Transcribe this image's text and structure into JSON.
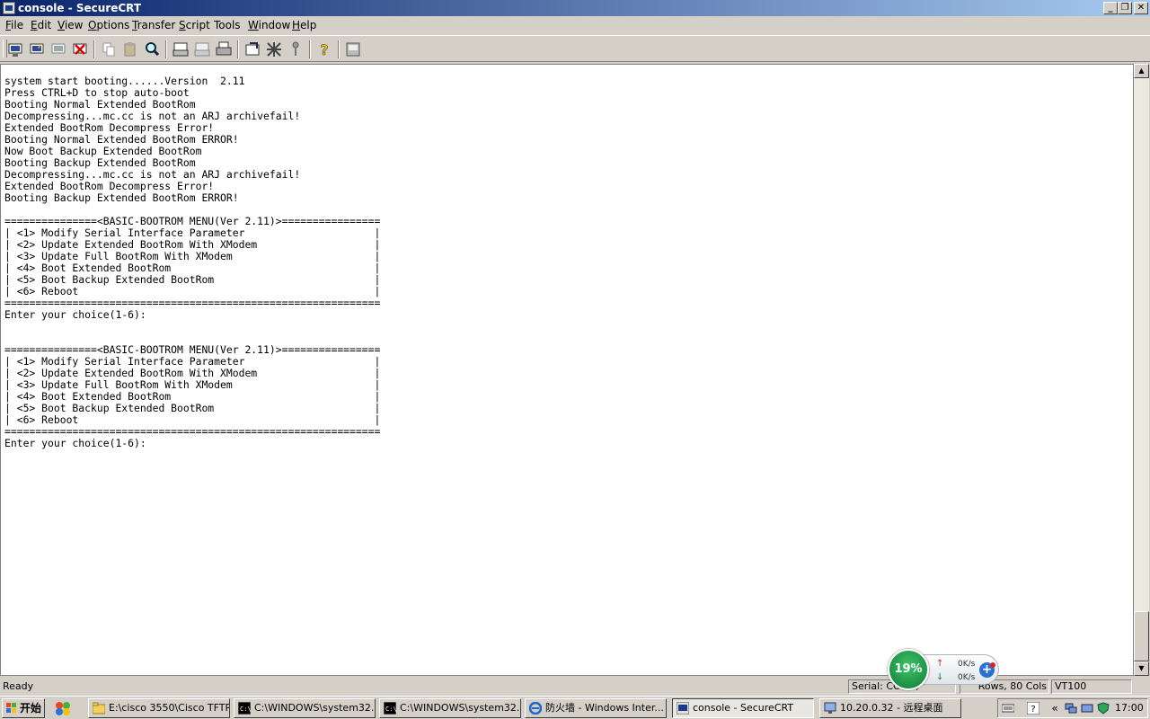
{
  "window": {
    "title": "console - SecureCRT",
    "controls": {
      "minimize": "_",
      "restore": "❐",
      "close": "✕"
    }
  },
  "menu": [
    {
      "label": "File",
      "key": "F",
      "rest": "ile"
    },
    {
      "label": "Edit",
      "key": "E",
      "rest": "dit"
    },
    {
      "label": "View",
      "key": "V",
      "rest": "iew"
    },
    {
      "label": "Options",
      "key": "O",
      "rest": "ptions"
    },
    {
      "label": "Transfer",
      "key": "T",
      "rest": "ransfer"
    },
    {
      "label": "Script",
      "key": "S",
      "rest": "cript"
    },
    {
      "label": "Tools",
      "key": "",
      "rest": "Tools"
    },
    {
      "label": "Window",
      "key": "W",
      "rest": "indow"
    },
    {
      "label": "Help",
      "key": "H",
      "rest": "elp"
    }
  ],
  "toolbar_icons": [
    "connect-icon",
    "quick-connect-icon",
    "reconnect-icon",
    "disconnect-icon",
    "copy-icon",
    "paste-icon",
    "find-icon",
    "print-screen-icon",
    "print-selection-icon",
    "print-icon",
    "session-options-icon",
    "global-options-icon",
    "keymap-icon",
    "help-icon",
    "sftp-icon"
  ],
  "terminal": {
    "lines": [
      "system start booting......Version  2.11",
      "Press CTRL+D to stop auto-boot",
      "Booting Normal Extended BootRom",
      "Decompressing...mc.cc is not an ARJ archivefail!",
      "Extended BootRom Decompress Error!",
      "Booting Normal Extended BootRom ERROR!",
      "Now Boot Backup Extended BootRom",
      "Booting Backup Extended BootRom",
      "Decompressing...mc.cc is not an ARJ archivefail!",
      "Extended BootRom Decompress Error!",
      "Booting Backup Extended BootRom ERROR!",
      "",
      "===============<BASIC-BOOTROM MENU(Ver 2.11)>================",
      "| <1> Modify Serial Interface Parameter                     |",
      "| <2> Update Extended BootRom With XModem                   |",
      "| <3> Update Full BootRom With XModem                       |",
      "| <4> Boot Extended BootRom                                 |",
      "| <5> Boot Backup Extended BootRom                          |",
      "| <6> Reboot                                                |",
      "=============================================================",
      "Enter your choice(1-6):",
      "",
      "",
      "===============<BASIC-BOOTROM MENU(Ver 2.11)>================",
      "| <1> Modify Serial Interface Parameter                     |",
      "| <2> Update Extended BootRom With XModem                   |",
      "| <3> Update Full BootRom With XModem                       |",
      "| <4> Boot Extended BootRom                                 |",
      "| <5> Boot Backup Extended BootRom                          |",
      "| <6> Reboot                                                |",
      "=============================================================",
      "Enter your choice(1-6):"
    ]
  },
  "scrollbar": {
    "up_arrow": "▲",
    "down_arrow": "▼"
  },
  "status": {
    "ready": "Ready",
    "serial": "Serial: COM1,",
    "rows_cols": "Rows, 80 Cols",
    "emulation": "VT100"
  },
  "net_widget": {
    "cpu": "19%",
    "up_arrow": "↑",
    "down_arrow": "↓",
    "upload": "0K/s",
    "download": "0K/s",
    "plus": "+"
  },
  "taskbar": {
    "start_label": "开始",
    "tasks": [
      {
        "label": "E:\\cisco 3550\\Cisco TFTP...",
        "icon": "folder-icon",
        "active": false
      },
      {
        "label": "C:\\WINDOWS\\system32...",
        "icon": "cmd-icon",
        "active": false
      },
      {
        "label": "C:\\WINDOWS\\system32...",
        "icon": "cmd-icon",
        "active": false
      },
      {
        "label": "防火墙 - Windows Inter...",
        "icon": "ie-icon",
        "active": false
      },
      {
        "label": "console - SecureCRT",
        "icon": "securecrt-icon",
        "active": true
      },
      {
        "label": "10.20.0.32 - 远程桌面",
        "icon": "remote-desktop-icon",
        "active": false
      }
    ],
    "tray": {
      "chevron": "«",
      "clock": "17:00"
    }
  },
  "colors": {
    "title_start": "#0a246a",
    "title_end": "#a6caf0",
    "chrome": "#d4d0c8",
    "terminal_bg": "#ffffff",
    "terminal_fg": "#000000"
  }
}
